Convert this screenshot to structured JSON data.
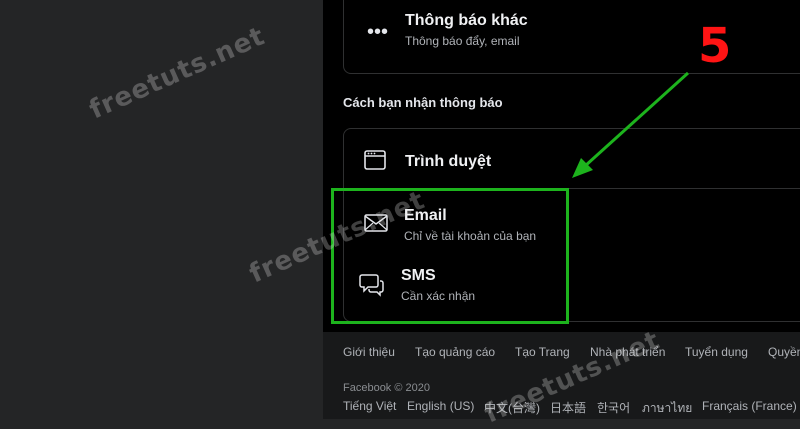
{
  "notifications": {
    "other": {
      "title": "Thông báo khác",
      "subtitle": "Thông báo đẩy, email"
    },
    "section_heading": "Cách bạn nhận thông báo",
    "methods": [
      {
        "title": "Trình duyệt",
        "subtitle": "",
        "icon": "browser-icon"
      },
      {
        "title": "Email",
        "subtitle": "Chỉ về tài khoản của bạn",
        "icon": "envelope-icon"
      },
      {
        "title": "SMS",
        "subtitle": "Cần xác nhận",
        "icon": "chat-bubbles-icon"
      }
    ]
  },
  "footer": {
    "links": [
      "Giới thiệu",
      "Tạo quảng cáo",
      "Tạo Trang",
      "Nhà phát triển",
      "Tuyển dụng",
      "Quyền"
    ],
    "copyright": "Facebook © 2020",
    "languages": [
      "Tiếng Việt",
      "English (US)",
      "中文(台灣)",
      "日本語",
      "한국어",
      "ภาษาไทย",
      "Français (France)"
    ]
  },
  "annotation": {
    "step_number": "5",
    "highlight_color": "#1db31d",
    "arrow_color": "#1db31d",
    "step_color": "#ff1414"
  },
  "watermark": {
    "text": "freetuts.net"
  }
}
